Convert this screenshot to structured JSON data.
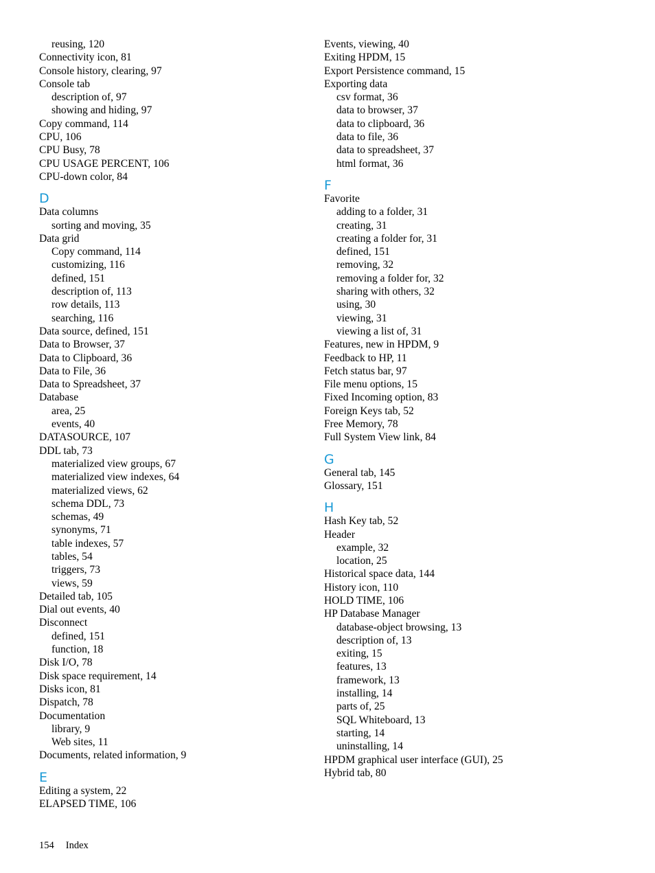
{
  "page": {
    "number": "154",
    "section": "Index"
  },
  "accent_color": "#1a9ad6",
  "left_column": [
    {
      "type": "sub",
      "text": "reusing, 120"
    },
    {
      "type": "main",
      "text": "Connectivity icon, 81"
    },
    {
      "type": "main",
      "text": "Console history, clearing, 97"
    },
    {
      "type": "main",
      "text": "Console tab"
    },
    {
      "type": "sub",
      "text": "description of, 97"
    },
    {
      "type": "sub",
      "text": "showing and hiding, 97"
    },
    {
      "type": "main",
      "text": "Copy command, 114"
    },
    {
      "type": "main",
      "text": "CPU, 106"
    },
    {
      "type": "main",
      "text": "CPU Busy, 78"
    },
    {
      "type": "main",
      "text": "CPU USAGE PERCENT, 106"
    },
    {
      "type": "main",
      "text": "CPU-down color, 84"
    },
    {
      "type": "letter",
      "text": "D"
    },
    {
      "type": "main",
      "text": "Data columns"
    },
    {
      "type": "sub",
      "text": "sorting and moving, 35"
    },
    {
      "type": "main",
      "text": "Data grid"
    },
    {
      "type": "sub",
      "text": "Copy command, 114"
    },
    {
      "type": "sub",
      "text": "customizing, 116"
    },
    {
      "type": "sub",
      "text": "defined, 151"
    },
    {
      "type": "sub",
      "text": "description of, 113"
    },
    {
      "type": "sub",
      "text": "row details, 113"
    },
    {
      "type": "sub",
      "text": "searching, 116"
    },
    {
      "type": "main",
      "text": "Data source, defined, 151"
    },
    {
      "type": "main",
      "text": "Data to Browser, 37"
    },
    {
      "type": "main",
      "text": "Data to Clipboard, 36"
    },
    {
      "type": "main",
      "text": "Data to File, 36"
    },
    {
      "type": "main",
      "text": "Data to Spreadsheet, 37"
    },
    {
      "type": "main",
      "text": "Database"
    },
    {
      "type": "sub",
      "text": "area, 25"
    },
    {
      "type": "sub",
      "text": "events, 40"
    },
    {
      "type": "main",
      "text": "DATASOURCE, 107"
    },
    {
      "type": "main",
      "text": "DDL tab, 73"
    },
    {
      "type": "sub",
      "text": "materialized view groups, 67"
    },
    {
      "type": "sub",
      "text": "materialized view indexes, 64"
    },
    {
      "type": "sub",
      "text": "materialized views, 62"
    },
    {
      "type": "sub",
      "text": "schema DDL, 73"
    },
    {
      "type": "sub",
      "text": "schemas, 49"
    },
    {
      "type": "sub",
      "text": "synonyms, 71"
    },
    {
      "type": "sub",
      "text": "table indexes, 57"
    },
    {
      "type": "sub",
      "text": "tables, 54"
    },
    {
      "type": "sub",
      "text": "triggers, 73"
    },
    {
      "type": "sub",
      "text": "views, 59"
    },
    {
      "type": "main",
      "text": "Detailed tab, 105"
    },
    {
      "type": "main",
      "text": "Dial out events, 40"
    },
    {
      "type": "main",
      "text": "Disconnect"
    },
    {
      "type": "sub",
      "text": "defined, 151"
    },
    {
      "type": "sub",
      "text": "function, 18"
    },
    {
      "type": "main",
      "text": "Disk I/O, 78"
    },
    {
      "type": "main",
      "text": "Disk space requirement, 14"
    },
    {
      "type": "main",
      "text": "Disks icon, 81"
    },
    {
      "type": "main",
      "text": "Dispatch, 78"
    },
    {
      "type": "main",
      "text": "Documentation"
    },
    {
      "type": "sub",
      "text": "library, 9"
    },
    {
      "type": "sub",
      "text": "Web sites, 11"
    },
    {
      "type": "main",
      "text": "Documents, related information, 9"
    },
    {
      "type": "letter",
      "text": "E"
    },
    {
      "type": "main",
      "text": "Editing a system, 22"
    },
    {
      "type": "main",
      "text": "ELAPSED TIME, 106"
    }
  ],
  "right_column": [
    {
      "type": "main",
      "text": "Events, viewing, 40"
    },
    {
      "type": "main",
      "text": "Exiting HPDM, 15"
    },
    {
      "type": "main",
      "text": "Export Persistence command, 15"
    },
    {
      "type": "main",
      "text": "Exporting data"
    },
    {
      "type": "sub",
      "text": "csv format, 36"
    },
    {
      "type": "sub",
      "text": "data to browser, 37"
    },
    {
      "type": "sub",
      "text": "data to clipboard, 36"
    },
    {
      "type": "sub",
      "text": "data to file, 36"
    },
    {
      "type": "sub",
      "text": "data to spreadsheet, 37"
    },
    {
      "type": "sub",
      "text": "html format, 36"
    },
    {
      "type": "letter",
      "text": "F"
    },
    {
      "type": "main",
      "text": "Favorite"
    },
    {
      "type": "sub",
      "text": "adding to a folder, 31"
    },
    {
      "type": "sub",
      "text": "creating, 31"
    },
    {
      "type": "sub",
      "text": "creating a folder for, 31"
    },
    {
      "type": "sub",
      "text": "defined, 151"
    },
    {
      "type": "sub",
      "text": "removing, 32"
    },
    {
      "type": "sub",
      "text": "removing a folder for, 32"
    },
    {
      "type": "sub",
      "text": "sharing with others, 32"
    },
    {
      "type": "sub",
      "text": "using, 30"
    },
    {
      "type": "sub",
      "text": "viewing, 31"
    },
    {
      "type": "sub",
      "text": "viewing a list of, 31"
    },
    {
      "type": "main",
      "text": "Features, new in HPDM, 9"
    },
    {
      "type": "main",
      "text": "Feedback to HP, 11"
    },
    {
      "type": "main",
      "text": "Fetch status bar, 97"
    },
    {
      "type": "main",
      "text": "File menu options, 15"
    },
    {
      "type": "main",
      "text": "Fixed Incoming option, 83"
    },
    {
      "type": "main",
      "text": "Foreign Keys tab, 52"
    },
    {
      "type": "main",
      "text": "Free Memory, 78"
    },
    {
      "type": "main",
      "text": "Full System View link, 84"
    },
    {
      "type": "letter",
      "text": "G"
    },
    {
      "type": "main",
      "text": "General tab, 145"
    },
    {
      "type": "main",
      "text": "Glossary, 151"
    },
    {
      "type": "letter",
      "text": "H"
    },
    {
      "type": "main",
      "text": "Hash Key tab, 52"
    },
    {
      "type": "main",
      "text": "Header"
    },
    {
      "type": "sub",
      "text": "example, 32"
    },
    {
      "type": "sub",
      "text": "location, 25"
    },
    {
      "type": "main",
      "text": "Historical space data, 144"
    },
    {
      "type": "main",
      "text": "History icon, 110"
    },
    {
      "type": "main",
      "text": "HOLD TIME, 106"
    },
    {
      "type": "main",
      "text": "HP Database Manager"
    },
    {
      "type": "sub",
      "text": "database-object browsing, 13"
    },
    {
      "type": "sub",
      "text": "description of, 13"
    },
    {
      "type": "sub",
      "text": "exiting, 15"
    },
    {
      "type": "sub",
      "text": "features, 13"
    },
    {
      "type": "sub",
      "text": "framework, 13"
    },
    {
      "type": "sub",
      "text": "installing, 14"
    },
    {
      "type": "sub",
      "text": "parts of, 25"
    },
    {
      "type": "sub",
      "text": "SQL Whiteboard, 13"
    },
    {
      "type": "sub",
      "text": "starting, 14"
    },
    {
      "type": "sub",
      "text": "uninstalling, 14"
    },
    {
      "type": "main",
      "text": "HPDM graphical user interface (GUI), 25"
    },
    {
      "type": "main",
      "text": "Hybrid tab, 80"
    }
  ]
}
